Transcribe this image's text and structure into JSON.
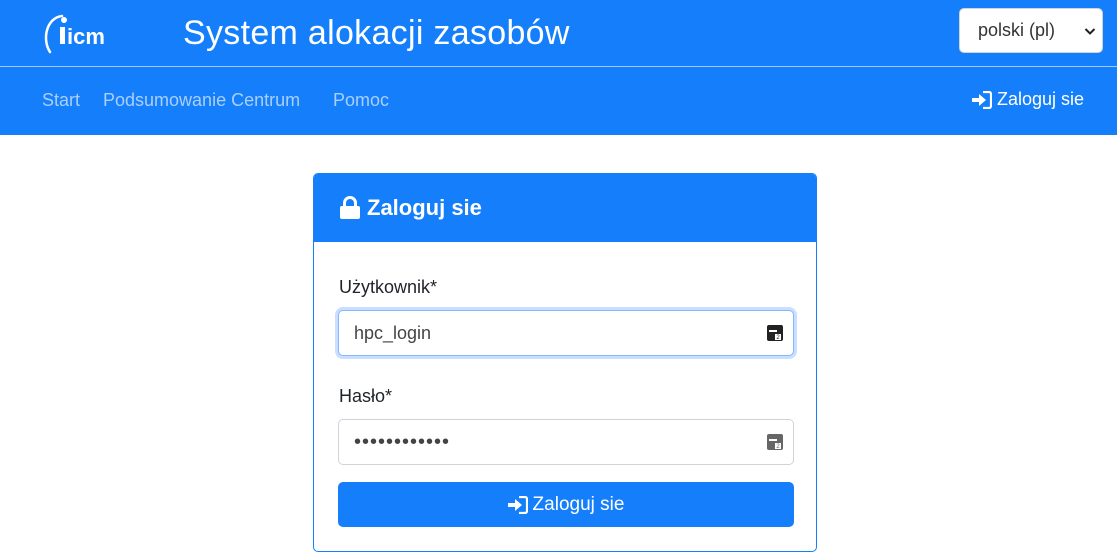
{
  "header": {
    "logo_text": "icm",
    "title": "System alokacji zasobów",
    "language": {
      "selected": "polski (pl)"
    }
  },
  "nav": {
    "items": [
      {
        "label": "Start"
      },
      {
        "label": "Podsumowanie Centrum"
      },
      {
        "label": "Pomoc"
      }
    ],
    "login_label": "Zaloguj sie"
  },
  "login_card": {
    "title": "Zaloguj sie",
    "username": {
      "label": "Użytkownik*",
      "value": "hpc_login"
    },
    "password": {
      "label": "Hasło*",
      "value": "••••••••••••"
    },
    "submit_label": "Zaloguj sie"
  },
  "colors": {
    "primary": "#157ffb",
    "nav_link": "#a9cfff",
    "focus_ring": "#86b7fe"
  }
}
